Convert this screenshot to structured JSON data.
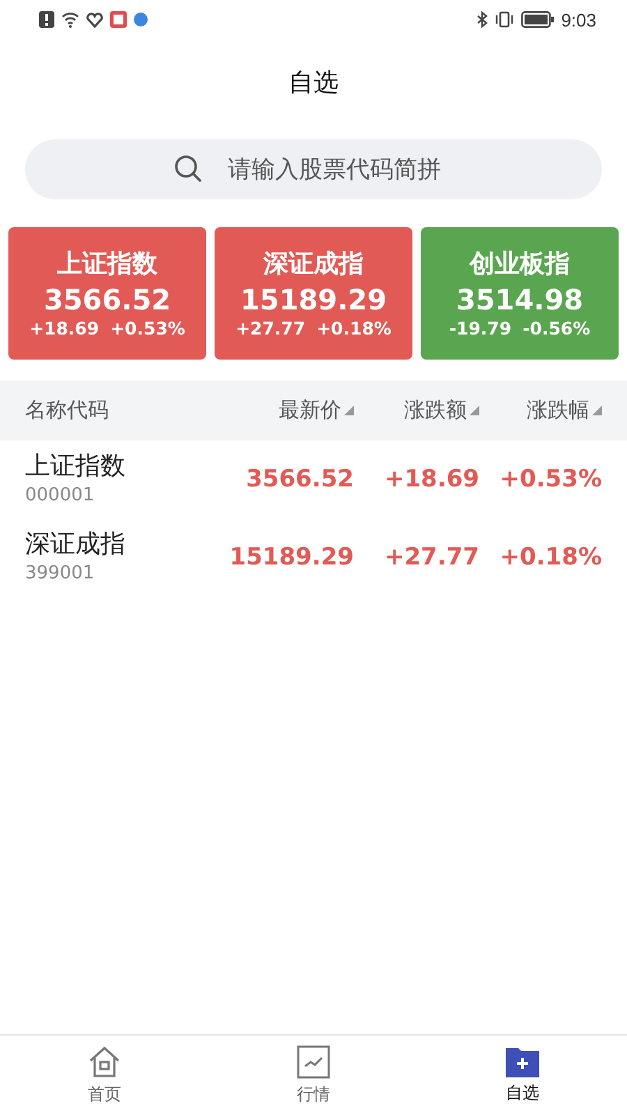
{
  "status_bar": {
    "time": "9:03"
  },
  "title": "自选",
  "search": {
    "placeholder": "请输入股票代码简拼"
  },
  "index_cards": [
    {
      "name": "上证指数",
      "price": "3566.52",
      "change": "+18.69",
      "percent": "+0.53%",
      "color": "#e25a55"
    },
    {
      "name": "深证成指",
      "price": "15189.29",
      "change": "+27.77",
      "percent": "+0.18%",
      "color": "#e25a55"
    },
    {
      "name": "创业板指",
      "price": "3514.98",
      "change": "-19.79",
      "percent": "-0.56%",
      "color": "#5aa650"
    }
  ],
  "table": {
    "columns": [
      {
        "label": "名称代码",
        "sortable": false
      },
      {
        "label": "最新价",
        "sortable": true
      },
      {
        "label": "涨跌额",
        "sortable": true
      },
      {
        "label": "涨跌幅",
        "sortable": true
      }
    ],
    "rows": [
      {
        "name": "上证指数",
        "code": "000001",
        "price": "3566.52",
        "change": "+18.69",
        "percent": "+0.53%",
        "color": "#e25a55"
      },
      {
        "name": "深证成指",
        "code": "399001",
        "price": "15189.29",
        "change": "+27.77",
        "percent": "+0.18%",
        "color": "#e25a55"
      }
    ]
  },
  "tabs": [
    {
      "label": "首页",
      "kind": "home",
      "selected": false
    },
    {
      "label": "行情",
      "kind": "market",
      "selected": false
    },
    {
      "label": "自选",
      "kind": "watchlist",
      "selected": true
    }
  ]
}
